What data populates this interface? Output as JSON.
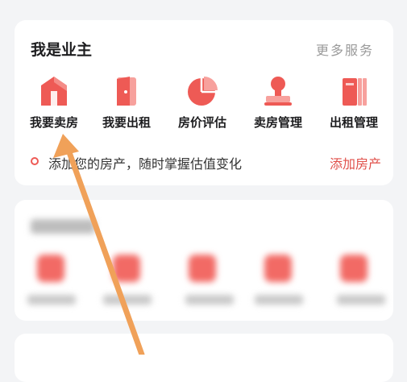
{
  "owner_section": {
    "title": "我是业主",
    "more_label": "更多服务",
    "items": [
      {
        "label": "我要卖房",
        "icon": "house-icon"
      },
      {
        "label": "我要出租",
        "icon": "door-icon"
      },
      {
        "label": "房价评估",
        "icon": "pie-chart-icon"
      },
      {
        "label": "卖房管理",
        "icon": "stamp-icon"
      },
      {
        "label": "出租管理",
        "icon": "book-icon"
      }
    ],
    "tip_text": "添加您的房产，随时掌握估值变化",
    "add_label": "添加房产"
  },
  "colors": {
    "accent": "#ee5a55",
    "accent_light": "#f7a19d",
    "arrow": "#f0a159"
  }
}
